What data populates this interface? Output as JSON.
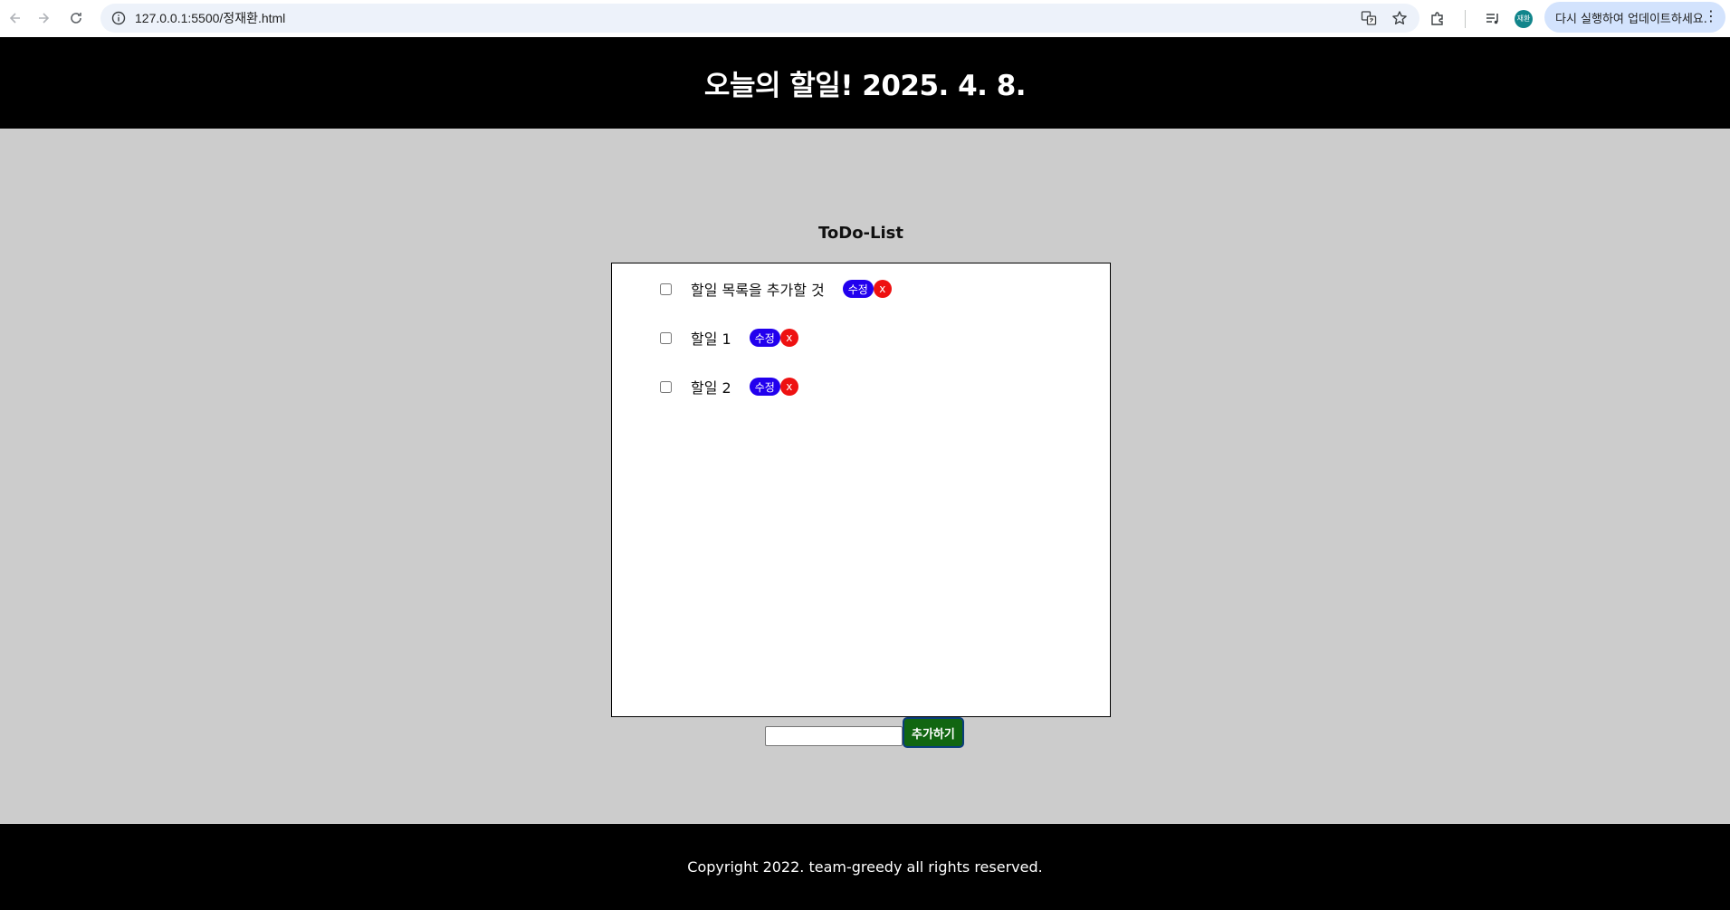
{
  "browser": {
    "url": "127.0.0.1:5500/정재환.html",
    "avatar_text": "재환",
    "update_label": "다시 실행하여 업데이트하세요.",
    "icons": [
      "back-icon",
      "forward-icon",
      "reload-icon",
      "info-icon",
      "translate-icon",
      "star-icon",
      "extensions-icon",
      "media-icon",
      "menu-dots-icon"
    ]
  },
  "header": {
    "title": "오늘의 할일! 2025. 4. 8."
  },
  "main": {
    "list_title": "ToDo-List",
    "items": [
      {
        "text": "할일 목록을 추가할 것",
        "checked": false,
        "edit_label": "수정",
        "delete_label": "x"
      },
      {
        "text": "할일 1",
        "checked": false,
        "edit_label": "수정",
        "delete_label": "x"
      },
      {
        "text": "할일 2",
        "checked": false,
        "edit_label": "수정",
        "delete_label": "x"
      }
    ],
    "add_input_value": "",
    "add_button_label": "추가하기"
  },
  "footer": {
    "copyright": "Copyright 2022. team-greedy all rights reserved."
  },
  "colors": {
    "header_bg": "#000000",
    "page_bg": "#cccccc",
    "edit_button": "#2200ee",
    "delete_button": "#ee1111",
    "add_button": "#116611"
  }
}
